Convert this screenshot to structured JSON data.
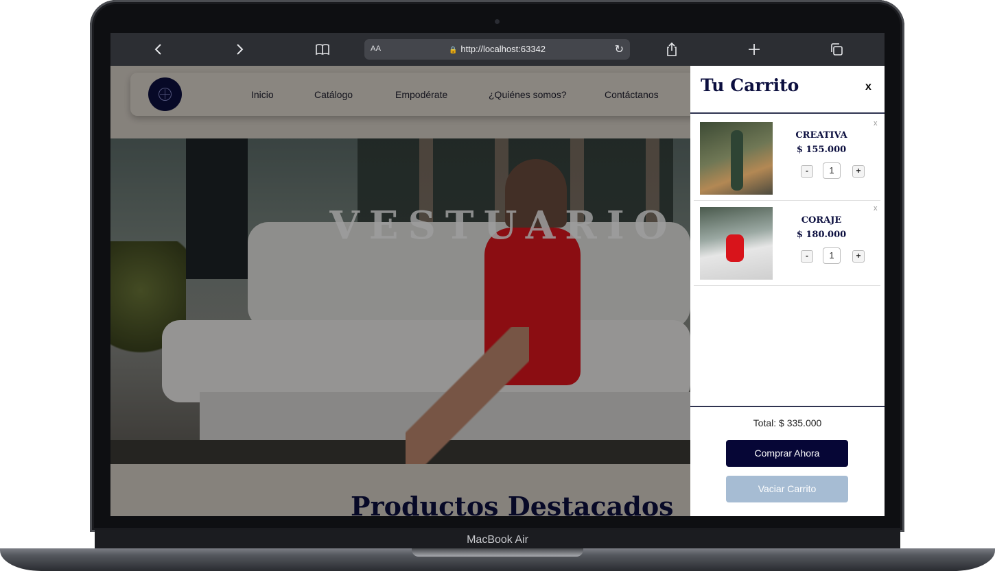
{
  "device": {
    "label": "MacBook Air"
  },
  "browser": {
    "reader_label": "AA",
    "url": "http://localhost:63342",
    "icons": {
      "back": "chevron-left-icon",
      "forward": "chevron-right-icon",
      "bookmarks": "book-icon",
      "lock": "lock-icon",
      "reload": "reload-icon",
      "share": "share-icon",
      "new_tab": "plus-icon",
      "tabs": "tabs-icon"
    }
  },
  "site": {
    "nav": [
      "Inicio",
      "Catálogo",
      "Empodérate",
      "¿Quiénes somos?",
      "Contáctanos"
    ],
    "hero_title": "VESTUARIO",
    "section_title": "Productos Destacados"
  },
  "cart": {
    "title": "Tu Carrito",
    "close_label": "x",
    "items": [
      {
        "name": "CREATIVA",
        "price": "$ 155.000",
        "qty": "1",
        "remove": "x",
        "minus": "-",
        "plus": "+"
      },
      {
        "name": "CORAJE",
        "price": "$ 180.000",
        "qty": "1",
        "remove": "x",
        "minus": "-",
        "plus": "+"
      }
    ],
    "total": "Total: $ 335.000",
    "buy_label": "Comprar Ahora",
    "empty_label": "Vaciar Carrito"
  },
  "colors": {
    "brand_navy": "#060636",
    "empty_button": "#a6bcd3",
    "dress_red": "#e0161d"
  }
}
